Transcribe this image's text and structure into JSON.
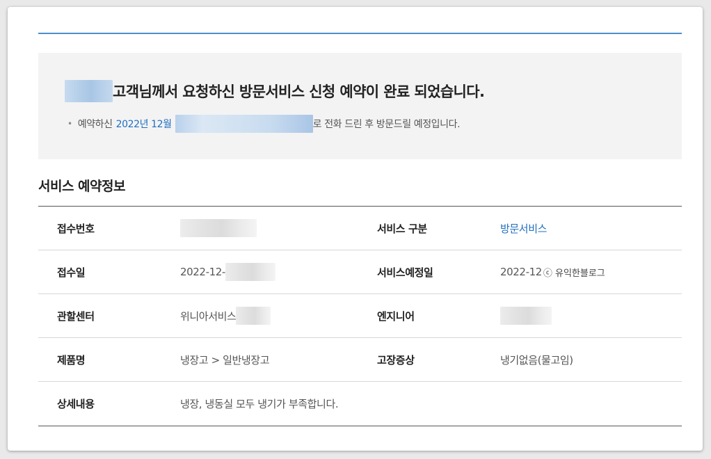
{
  "notice": {
    "title": "고객님께서 요청하신 방문서비스 신청 예약이 완료 되었습니다.",
    "line_prefix": "예약하신",
    "line_date": "2022년 12월",
    "line_suffix": "로 전화 드린 후 방문드릴 예정입니다."
  },
  "section_title": "서비스 예약정보",
  "rows": [
    {
      "label1": "접수번호",
      "value1": "",
      "label2": "서비스 구분",
      "value2": "방문서비스"
    },
    {
      "label1": "접수일",
      "value1": "2022-12-",
      "label2": "서비스예정일",
      "value2": "2022-12"
    },
    {
      "label1": "관할센터",
      "value1": "위니아서비스",
      "label2": "엔지니어",
      "value2": ""
    },
    {
      "label1": "제품명",
      "value1": "냉장고 > 일반냉장고",
      "label2": "고장증상",
      "value2": "냉기없음(물고임)"
    },
    {
      "label1": "상세내용",
      "value1": "냉장, 냉동실 모두 냉기가 부족합니다."
    }
  ],
  "watermark": "ⓒ 유익한블로그",
  "colors": {
    "accent": "#1f6fbf",
    "rule": "#4a90c8",
    "notice_bg": "#f3f3f4"
  }
}
